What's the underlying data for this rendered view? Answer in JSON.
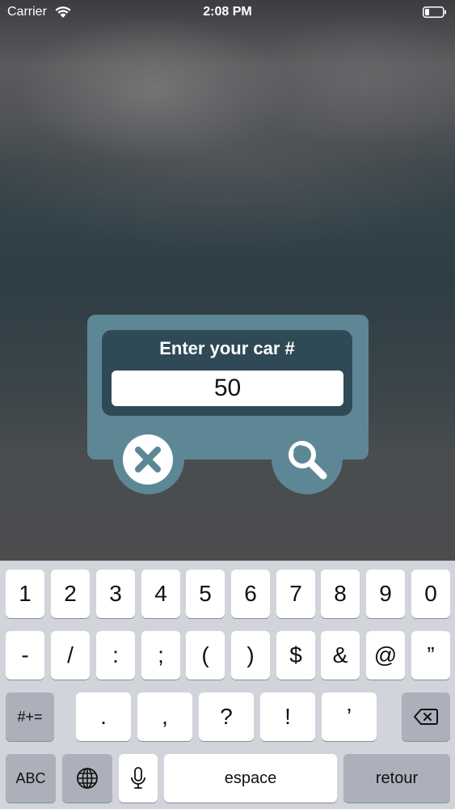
{
  "status_bar": {
    "carrier": "Carrier",
    "time": "2:08 PM"
  },
  "dialog": {
    "prompt": "Enter your car #",
    "car_number_value": "50",
    "accent": "#5e8796",
    "window_color": "#2f4a56",
    "cancel_icon": "close-icon",
    "search_icon": "magnifier-icon"
  },
  "keyboard": {
    "row1": [
      "1",
      "2",
      "3",
      "4",
      "5",
      "6",
      "7",
      "8",
      "9",
      "0"
    ],
    "row2": [
      "-",
      "/",
      ":",
      ";",
      "(",
      ")",
      "$",
      "&",
      "@",
      "”"
    ],
    "row3_symbols_toggle": "#+=",
    "row3": [
      ".",
      ",",
      "?",
      "!",
      "’"
    ],
    "backspace_icon": "backspace-icon",
    "row4": {
      "abc": "ABC",
      "globe_icon": "globe-icon",
      "mic_icon": "microphone-icon",
      "space": "espace",
      "return": "retour"
    }
  }
}
